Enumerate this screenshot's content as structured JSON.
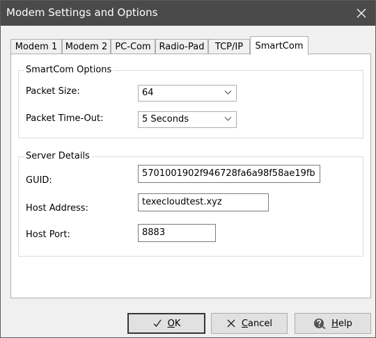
{
  "window": {
    "title": "Modem Settings and Options"
  },
  "tabs": [
    {
      "label": "Modem 1"
    },
    {
      "label": "Modem 2"
    },
    {
      "label": "PC-Com"
    },
    {
      "label": "Radio-Pad"
    },
    {
      "label": "TCP/IP"
    },
    {
      "label": "SmartCom",
      "active": true
    }
  ],
  "smartcom_options": {
    "legend": "SmartCom Options",
    "packet_size_label": "Packet Size:",
    "packet_size_value": "64",
    "packet_timeout_label": "Packet Time-Out:",
    "packet_timeout_value": "5 Seconds"
  },
  "server_details": {
    "legend": "Server Details",
    "guid_label": "GUID:",
    "guid_value": "5701001902f946728fa6a98f58ae19fb",
    "host_address_label": "Host Address:",
    "host_address_value": "texecloudtest.xyz",
    "host_port_label": "Host Port:",
    "host_port_value": "8883"
  },
  "buttons": {
    "ok": {
      "mnemonic": "O",
      "rest": "K"
    },
    "cancel": {
      "mnemonic": "C",
      "rest": "ancel"
    },
    "help": {
      "mnemonic": "H",
      "rest": "elp"
    }
  },
  "icons": {
    "close": "close-icon",
    "check": "check-icon",
    "cancel": "x-icon",
    "help": "help-icon",
    "dropdown": "chevron-down-icon"
  }
}
